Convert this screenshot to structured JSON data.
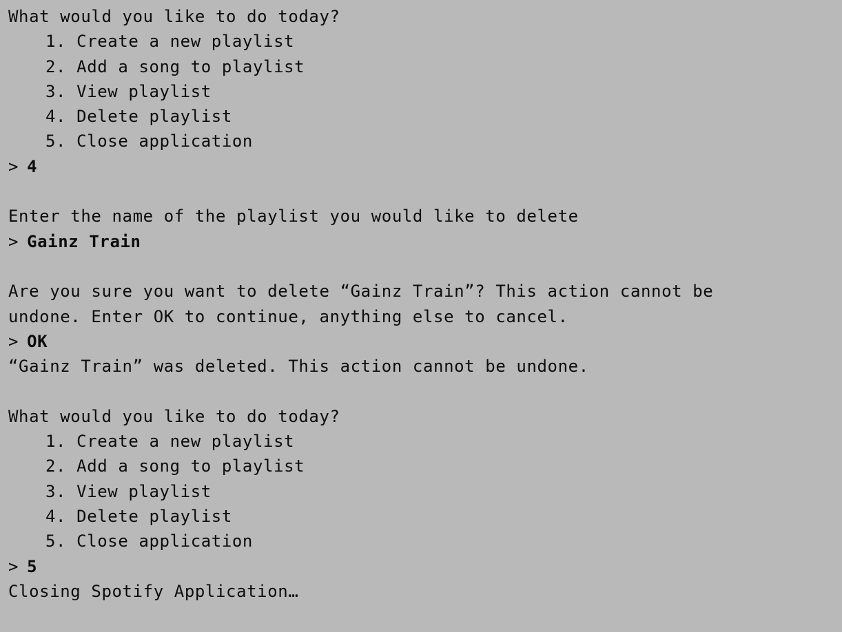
{
  "terminal": {
    "menu_title": "What would you like to do today?",
    "menu_items": [
      "1. Create a new playlist",
      "2. Add a song to playlist",
      "3. View playlist",
      "4. Delete playlist",
      "5. Close application"
    ],
    "prompt_symbol": ">",
    "first_choice": "4",
    "delete_prompt": "Enter the name of the playlist you would like to delete",
    "playlist_name_input": "Gainz Train",
    "confirm_line_1": "Are you sure you want to delete “Gainz Train”? This action cannot be",
    "confirm_line_2": "undone. Enter OK to continue, anything else to cancel.",
    "confirm_input": "OK",
    "deleted_message": "“Gainz Train” was deleted. This action cannot be undone.",
    "second_choice": "5",
    "closing_message": "Closing Spotify Application…"
  }
}
